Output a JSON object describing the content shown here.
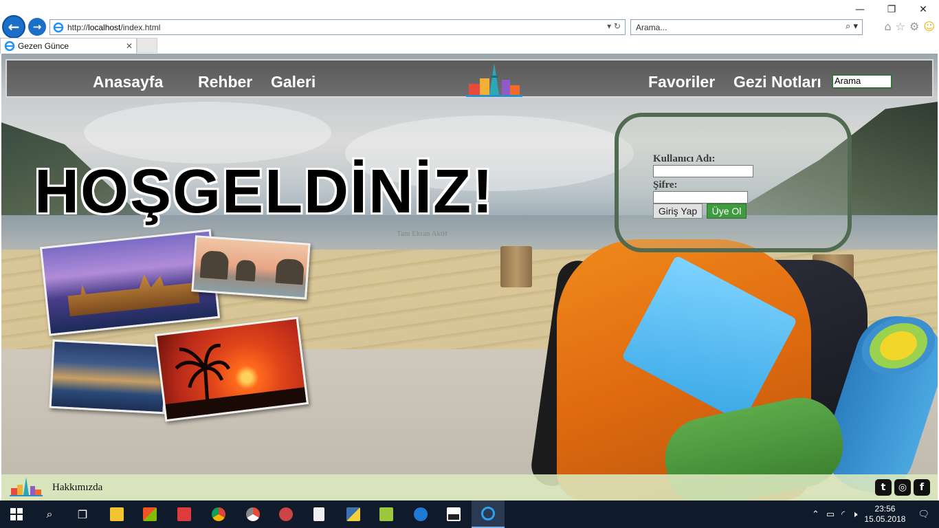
{
  "browser": {
    "url_prefix": "http://",
    "url_host": "localhost",
    "url_path": "/index.html",
    "search_placeholder": "Arama...",
    "tab_title": "Gezen Günce"
  },
  "nav": {
    "items": [
      "Anasayfa",
      "Rehber",
      "Galeri",
      "Favoriler",
      "Gezi Notları"
    ],
    "search_value": "Arama"
  },
  "hero": {
    "welcome": "HOŞGELDİNİZ!",
    "faint_text": "Tam Ekran Aktif"
  },
  "login": {
    "username_label": "Kullanıcı Adı:",
    "password_label": "Şifre:",
    "login_button": "Giriş Yap",
    "signup_button": "Üye Ol"
  },
  "footer": {
    "about": "Hakkımızda"
  },
  "taskbar": {
    "time": "23:56",
    "date": "15.05.2018"
  },
  "colors": {
    "nav_bg": "#5a5a5a",
    "login_border": "#516a52",
    "signup_bg": "#3f9b3f",
    "footer_bg": "#dce8be",
    "taskbar_bg": "#0f1a2a"
  }
}
